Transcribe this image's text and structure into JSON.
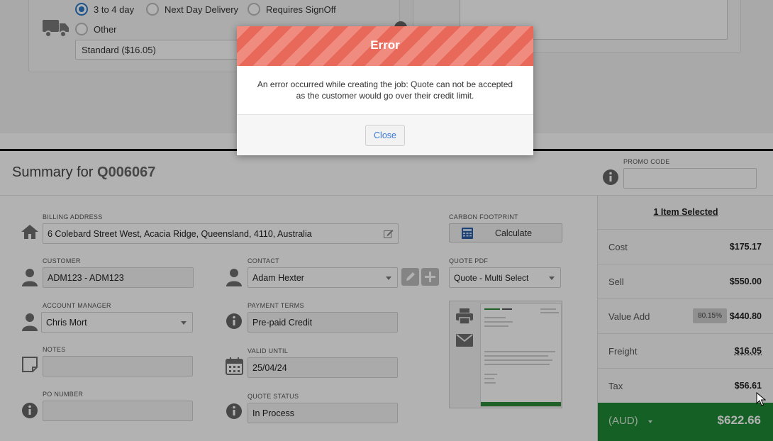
{
  "shipping": {
    "options": [
      {
        "label": "3 to 4 day",
        "selected": true
      },
      {
        "label": "Next Day Delivery",
        "selected": false
      },
      {
        "label": "Requires SignOff",
        "selected": false
      },
      {
        "label": "Other",
        "selected": false
      }
    ],
    "selected_rate": "Standard ($16.05)"
  },
  "summary": {
    "title_prefix": "Summary for",
    "quote_id": "Q006067",
    "promo_code_label": "PROMO CODE",
    "promo_code_value": ""
  },
  "form": {
    "billing_address": {
      "label": "BILLING ADDRESS",
      "value": "6 Colebard Street West, Acacia Ridge, Queensland, 4110, Australia"
    },
    "customer": {
      "label": "CUSTOMER",
      "value": "ADM123 - ADM123"
    },
    "contact": {
      "label": "CONTACT",
      "value": "Adam Hexter"
    },
    "account_manager": {
      "label": "ACCOUNT MANAGER",
      "value": "Chris Mort"
    },
    "payment_terms": {
      "label": "PAYMENT TERMS",
      "value": "Pre-paid Credit"
    },
    "notes": {
      "label": "NOTES",
      "value": ""
    },
    "valid_until": {
      "label": "VALID UNTIL",
      "value": "25/04/24"
    },
    "po_number": {
      "label": "PO NUMBER",
      "value": ""
    },
    "quote_status": {
      "label": "QUOTE STATUS",
      "value": "In Process"
    },
    "carbon_footprint": {
      "label": "CARBON FOOTPRINT",
      "button": "Calculate"
    },
    "quote_pdf": {
      "label": "QUOTE PDF",
      "value": "Quote - Multi Select"
    }
  },
  "totals": {
    "items_selected": "1 Item Selected",
    "rows": [
      {
        "label": "Cost",
        "value": "$175.17"
      },
      {
        "label": "Sell",
        "value": "$550.00"
      },
      {
        "label": "Value Add",
        "value": "$440.80",
        "badge": "80.15%"
      },
      {
        "label": "Freight",
        "value": "$16.05"
      },
      {
        "label": "Tax",
        "value": "$56.61"
      }
    ],
    "currency": "(AUD)",
    "grand_total": "$622.66"
  },
  "modal": {
    "title": "Error",
    "message": "An error occurred while creating the job: Quote can not be accepted as the customer would go over their credit limit.",
    "close_label": "Close"
  },
  "colors": {
    "accent_blue": "#2a79c7",
    "total_green": "#1f8a36",
    "error_red": "#e8685a"
  }
}
